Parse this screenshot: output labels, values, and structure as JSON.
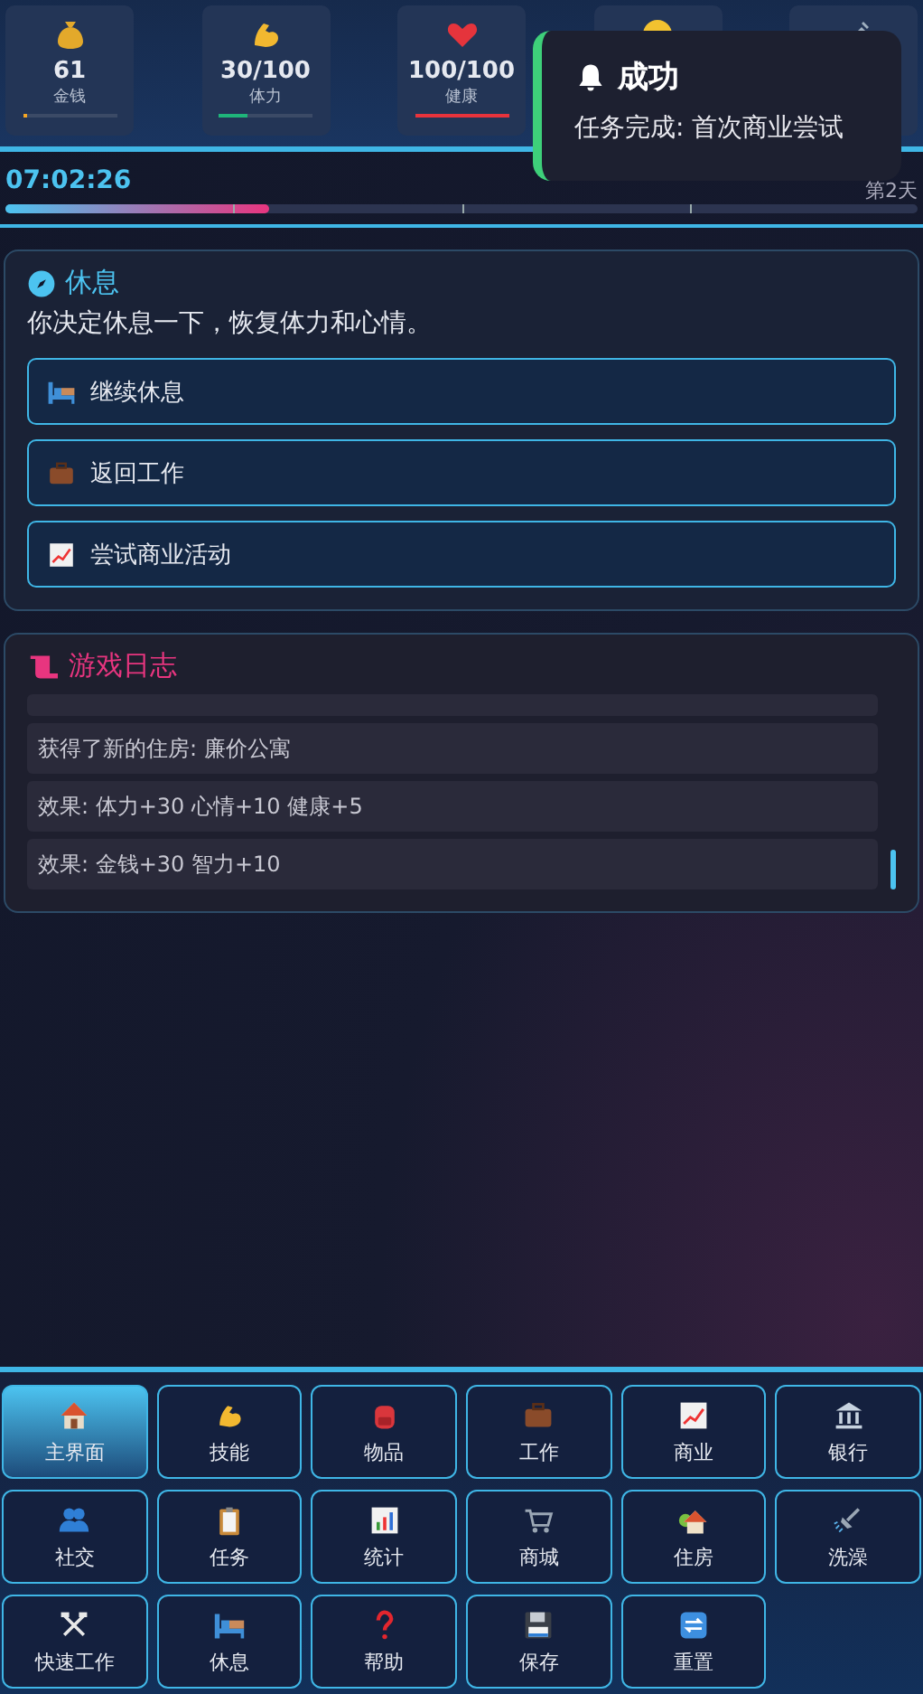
{
  "stats": [
    {
      "kind": "stat",
      "value": "61",
      "label": "金钱",
      "level": 0.05,
      "color": "#f5a623"
    },
    {
      "kind": "stat",
      "value": "30/100",
      "label": "体力",
      "level": 0.3,
      "color": "#1fb57a"
    },
    {
      "kind": "stat",
      "value": "100/100",
      "label": "健康",
      "level": 1,
      "color": "#e8333c"
    },
    {
      "kind": "covered"
    },
    {
      "kind": "covered"
    }
  ],
  "toast": {
    "title": "成功",
    "message": "任务完成: 首次商业尝试"
  },
  "clock": {
    "time": "07:02:26",
    "day": "第2天",
    "level": 0.29
  },
  "event": {
    "title": "休息",
    "text": "你决定休息一下，恢复体力和心情。",
    "options": [
      "继续休息",
      "返回工作",
      "尝试商业活动"
    ]
  },
  "log": {
    "title": "游戏日志",
    "entries": [
      "获得了新的住房: 廉价公寓",
      "效果: 体力+30 心情+10 健康+5",
      "效果: 金钱+30 智力+10"
    ]
  },
  "nav": [
    {
      "label": "主界面",
      "selected": true
    },
    {
      "label": "技能",
      "selected": false
    },
    {
      "label": "物品",
      "selected": false
    },
    {
      "label": "工作",
      "selected": false
    },
    {
      "label": "商业",
      "selected": false
    },
    {
      "label": "银行",
      "selected": false
    },
    {
      "label": "社交",
      "selected": false
    },
    {
      "label": "任务",
      "selected": false
    },
    {
      "label": "统计",
      "selected": false
    },
    {
      "label": "商城",
      "selected": false
    },
    {
      "label": "住房",
      "selected": false
    },
    {
      "label": "洗澡",
      "selected": false
    },
    {
      "label": "快速工作",
      "selected": false
    },
    {
      "label": "休息",
      "selected": false
    },
    {
      "label": "帮助",
      "selected": false
    },
    {
      "label": "保存",
      "selected": false
    },
    {
      "label": "重置",
      "selected": false
    }
  ]
}
